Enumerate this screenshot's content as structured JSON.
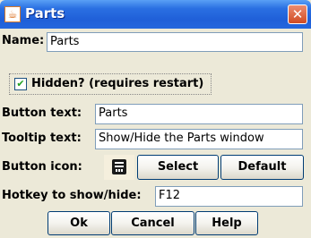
{
  "window": {
    "title": "Parts",
    "close_label": "✕"
  },
  "form": {
    "name_label": "Name:",
    "name_value": "Parts",
    "hidden_label": "Hidden? (requires restart)",
    "hidden_checked_glyph": "✔",
    "button_text_label": "Button text:",
    "button_text_value": "Parts",
    "tooltip_label": "Tooltip text:",
    "tooltip_value": "Show/Hide the Parts window",
    "button_icon_label": "Button icon:",
    "select_label": "Select",
    "default_label": "Default",
    "hotkey_label": "Hotkey to show/hide:",
    "hotkey_value": "F12"
  },
  "footer": {
    "ok_label": "Ok",
    "cancel_label": "Cancel",
    "help_label": "Help"
  },
  "colors": {
    "titlebar": "#2a6fe2",
    "dialog_bg": "#ece9d8",
    "close": "#d04b22"
  }
}
